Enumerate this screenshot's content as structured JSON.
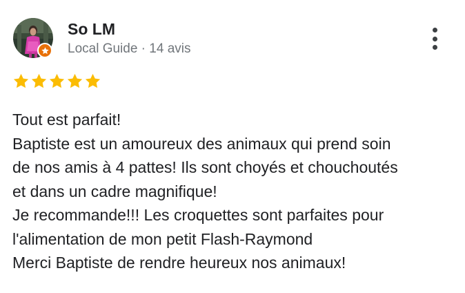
{
  "review": {
    "author": {
      "name": "So LM",
      "meta": "Local Guide · 14 avis",
      "avatar_icon": "user-photo-avatar",
      "badge_icon": "local-guide-star-icon",
      "badge_color": "#e8710a"
    },
    "more_icon": "more-vert-icon",
    "rating": {
      "stars": 5,
      "max": 5,
      "star_color": "#fbbc04"
    },
    "text_lines": [
      "Tout est parfait!",
      "Baptiste est un amoureux des animaux qui prend soin",
      "de nos amis à 4 pattes! Ils sont choyés et chouchoutés",
      "et dans un cadre magnifique!",
      "Je recommande!!! Les croquettes sont parfaites pour",
      "l'alimentation de mon petit Flash-Raymond",
      "Merci Baptiste de rendre heureux nos animaux!"
    ]
  }
}
